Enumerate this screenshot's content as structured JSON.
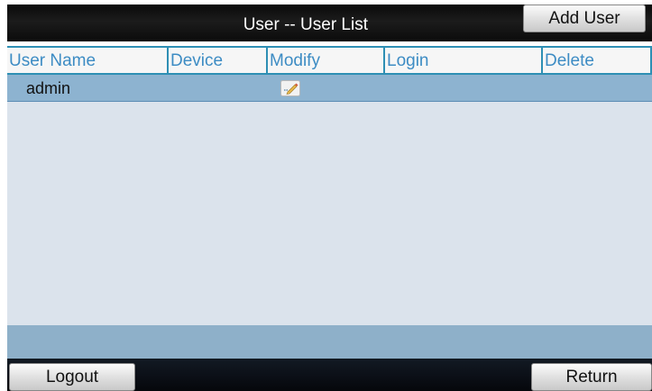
{
  "header": {
    "title": "User -- User List",
    "add_user_label": "Add User"
  },
  "table": {
    "columns": [
      "User Name",
      "Device",
      "Modify",
      "Login",
      "Delete"
    ],
    "rows": [
      {
        "user_name": "admin",
        "modify_icon": "edit-icon"
      }
    ]
  },
  "footer": {
    "logout_label": "Logout",
    "return_label": "Return"
  },
  "colors": {
    "header_bg": "#111111",
    "column_text": "#3d8cc4",
    "grid_line": "#2e8fb4",
    "selected_row": "#8db3d0",
    "body_bg": "#dbe3ec",
    "footer_strip": "#8eb0c9"
  }
}
